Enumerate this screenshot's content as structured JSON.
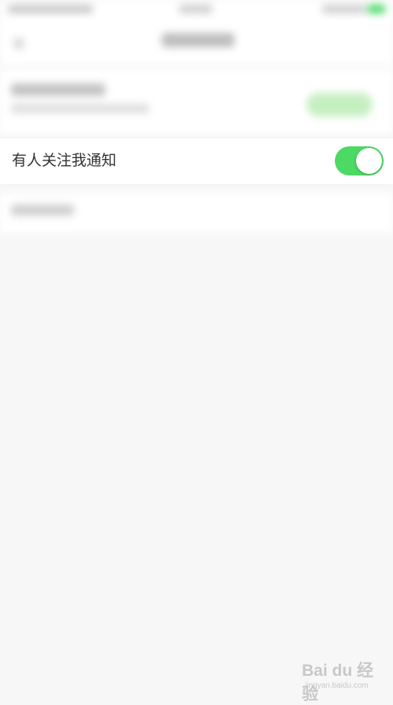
{
  "settings": {
    "follow_notification": {
      "label": "有人关注我通知",
      "enabled": true,
      "toggle_on_color": "#4cd964",
      "toggle_off_color": "#e5e5e5"
    }
  },
  "watermark": {
    "brand": "Bai du 经验",
    "url": "jingyan.baidu.com"
  },
  "colors": {
    "background": "#f7f7f7",
    "row_background": "#ffffff",
    "label_text": "#333333",
    "accent_green": "#4cd964"
  },
  "icons": {
    "back": "back-arrow-icon",
    "watermark_logo": "baidu-paw-icon"
  }
}
